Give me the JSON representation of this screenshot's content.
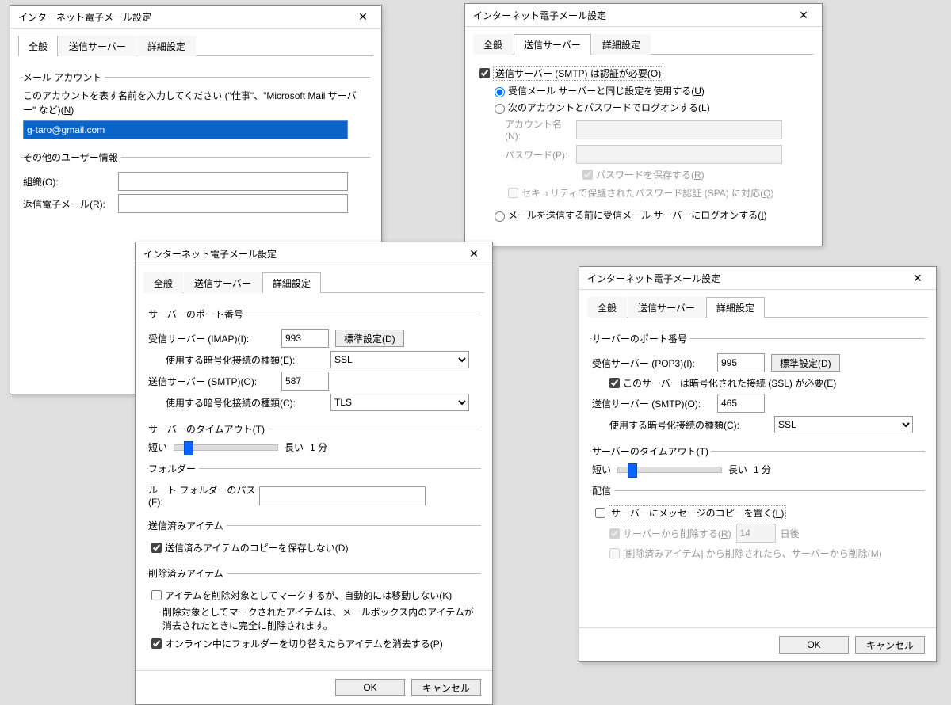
{
  "common": {
    "title": "インターネット電子メール設定",
    "tab_general": "全般",
    "tab_outgoing": "送信サーバー",
    "tab_advanced": "詳細設定",
    "ok": "OK",
    "cancel": "キャンセル"
  },
  "d1": {
    "grp_account": "メール アカウント",
    "account_desc1": "このアカウントを表す名前を入力してください (\"仕事\"、\"Microsoft Mail サーバー\" など)(",
    "account_desc_key": "N",
    "account_desc2": ")",
    "account_value": "g-taro@gmail.com",
    "grp_other": "その他のユーザー情報",
    "org_label": "組織(O):",
    "reply_label": "返信電子メール(R):"
  },
  "d2": {
    "auth_required1": "送信サーバー (SMTP) は認証が必要(",
    "auth_required_key": "O",
    "auth_required2": ")",
    "same1": "受信メール サーバーと同じ設定を使用する(",
    "same_key": "U",
    "same2": ")",
    "logon1": "次のアカウントとパスワードでログオンする(",
    "logon_key": "L",
    "logon2": ")",
    "acct_label": "アカウント名(N):",
    "pwd_label": "パスワード(P):",
    "save_pwd1": "パスワードを保存する(",
    "save_pwd_key": "R",
    "save_pwd2": ")",
    "spa1": "セキュリティで保護されたパスワード認証 (SPA) に対応(",
    "spa_key": "Q",
    "spa2": ")",
    "before1": "メールを送信する前に受信メール サーバーにログオンする(",
    "before_key": "I",
    "before2": ")"
  },
  "d3": {
    "grp_ports": "サーバーのポート番号",
    "imap_label": "受信サーバー (IMAP)(I):",
    "imap_port": "993",
    "default_btn": "標準設定(D)",
    "enc_in_label": "使用する暗号化接続の種類(E):",
    "enc_in_val": "SSL",
    "smtp_label": "送信サーバー (SMTP)(O):",
    "smtp_port": "587",
    "enc_out_label": "使用する暗号化接続の種類(C):",
    "enc_out_val": "TLS",
    "grp_timeout": "サーバーのタイムアウト(T)",
    "short": "短い",
    "long": "長い",
    "timeout_val": "1 分",
    "grp_folder": "フォルダー",
    "root_label": "ルート フォルダーのパス(F):",
    "grp_sent": "送信済みアイテム",
    "sent_chk": "送信済みアイテムのコピーを保存しない(D)",
    "grp_del": "削除済みアイテム",
    "del_chk": "アイテムを削除対象としてマークするが、自動的には移動しない(K)",
    "del_note": "削除対象としてマークされたアイテムは、メールボックス内のアイテムが消去されたときに完全に削除されます。",
    "purge_chk": "オンライン中にフォルダーを切り替えたらアイテムを消去する(P)"
  },
  "d4": {
    "grp_ports": "サーバーのポート番号",
    "pop3_label": "受信サーバー (POP3)(I):",
    "pop3_port": "995",
    "default_btn": "標準設定(D)",
    "ssl_chk": "このサーバーは暗号化された接続 (SSL) が必要(E)",
    "smtp_label": "送信サーバー (SMTP)(O):",
    "smtp_port": "465",
    "enc_label": "使用する暗号化接続の種類(C):",
    "enc_val": "SSL",
    "grp_timeout": "サーバーのタイムアウト(T)",
    "short": "短い",
    "long": "長い",
    "timeout_val": "1 分",
    "grp_deliv": "配信",
    "leave_chk1": "サーバーにメッセージのコピーを置く(",
    "leave_key": "L",
    "leave_chk2": ")",
    "remove_after1": "サーバーから削除する(",
    "remove_key": "R",
    "remove_after2": ")",
    "days_val": "14",
    "days_suffix": "日後",
    "remove_del1": "[削除済みアイテム] から削除されたら、サーバーから削除(",
    "remove_del_key": "M",
    "remove_del2": ")"
  }
}
